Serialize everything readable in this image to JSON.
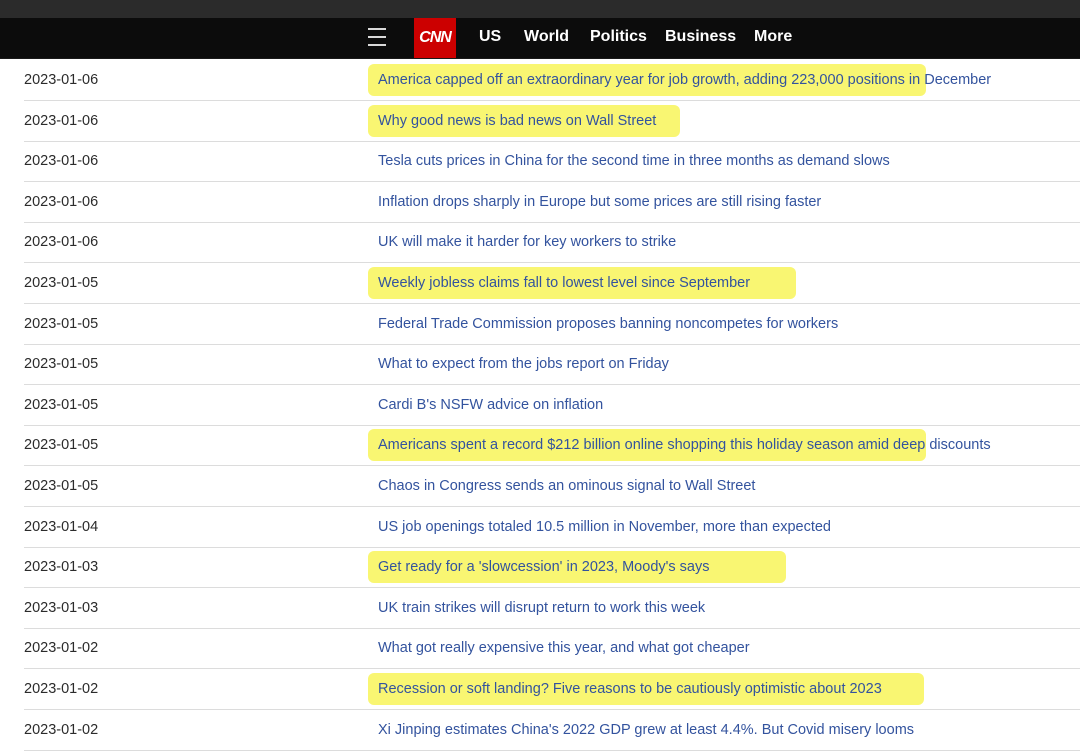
{
  "nav": {
    "logo": "CNN",
    "links": [
      "US",
      "World",
      "Politics",
      "Business",
      "More"
    ]
  },
  "colors": {
    "navbar": "#0c0c0c",
    "logo_bg": "#cc0000",
    "headline_link": "#33539e",
    "highlight": "#f7f34a"
  },
  "articles": [
    {
      "date": "2023-01-06",
      "title": "America capped off an extraordinary year for job growth, adding 223,000 positions in December",
      "highlighted": true
    },
    {
      "date": "2023-01-06",
      "title": "Why good news is bad news on Wall Street",
      "highlighted": true
    },
    {
      "date": "2023-01-06",
      "title": "Tesla cuts prices in China for the second time in three months as demand slows",
      "highlighted": false
    },
    {
      "date": "2023-01-06",
      "title": "Inflation drops sharply in Europe but some prices are still rising faster",
      "highlighted": false
    },
    {
      "date": "2023-01-06",
      "title": "UK will make it harder for key workers to strike",
      "highlighted": false
    },
    {
      "date": "2023-01-05",
      "title": "Weekly jobless claims fall to lowest level since September",
      "highlighted": true
    },
    {
      "date": "2023-01-05",
      "title": "Federal Trade Commission proposes banning noncompetes for workers",
      "highlighted": false
    },
    {
      "date": "2023-01-05",
      "title": "What to expect from the jobs report on Friday",
      "highlighted": false
    },
    {
      "date": "2023-01-05",
      "title": "Cardi B's NSFW advice on inflation",
      "highlighted": false
    },
    {
      "date": "2023-01-05",
      "title": "Americans spent a record $212 billion online shopping this holiday season amid deep discounts",
      "highlighted": true
    },
    {
      "date": "2023-01-05",
      "title": "Chaos in Congress sends an ominous signal to Wall Street",
      "highlighted": false
    },
    {
      "date": "2023-01-04",
      "title": "US job openings totaled 10.5 million in November, more than expected",
      "highlighted": false
    },
    {
      "date": "2023-01-03",
      "title": "Get ready for a 'slowcession' in 2023, Moody's says",
      "highlighted": true
    },
    {
      "date": "2023-01-03",
      "title": "UK train strikes will disrupt return to work this week",
      "highlighted": false
    },
    {
      "date": "2023-01-02",
      "title": "What got really expensive this year, and what got cheaper",
      "highlighted": false
    },
    {
      "date": "2023-01-02",
      "title": "Recession or soft landing? Five reasons to be cautiously optimistic about 2023",
      "highlighted": true
    },
    {
      "date": "2023-01-02",
      "title": "Xi Jinping estimates China's 2022 GDP grew at least 4.4%. But Covid misery looms",
      "highlighted": false
    }
  ]
}
